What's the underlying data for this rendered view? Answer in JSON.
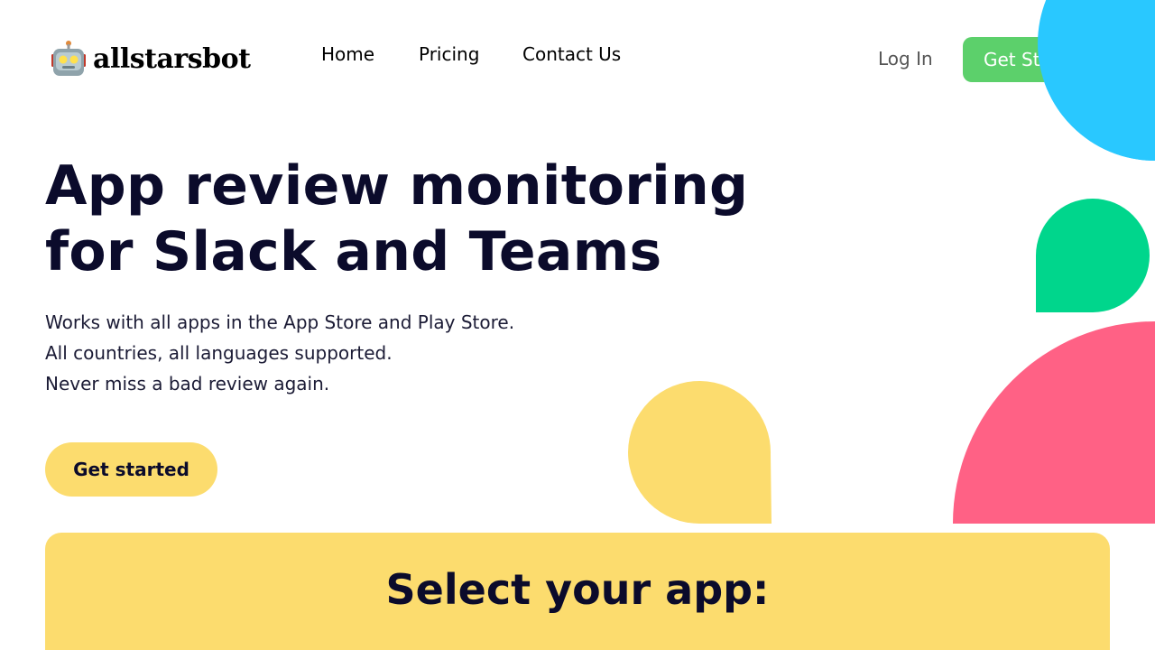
{
  "brand": {
    "name": "allstarsbot",
    "logo_icon": "robot-icon"
  },
  "nav": {
    "items": [
      {
        "label": "Home"
      },
      {
        "label": "Pricing"
      },
      {
        "label": "Contact Us"
      }
    ],
    "login_label": "Log In",
    "cta_label": "Get Started"
  },
  "hero": {
    "title_line1": "App review monitoring",
    "title_line2": "for Slack and Teams",
    "lines": [
      "Works with all apps in the App Store and Play Store.",
      "All countries, all languages supported.",
      "Never miss a bad review again."
    ],
    "cta_label": "Get started"
  },
  "select_panel": {
    "title": "Select your app:"
  },
  "colors": {
    "green": "#5cd06b",
    "yellow": "#fcdc6e",
    "blue": "#29c8ff",
    "teal": "#00d68c",
    "pink": "#ff6185",
    "text": "#0b0b2b"
  }
}
